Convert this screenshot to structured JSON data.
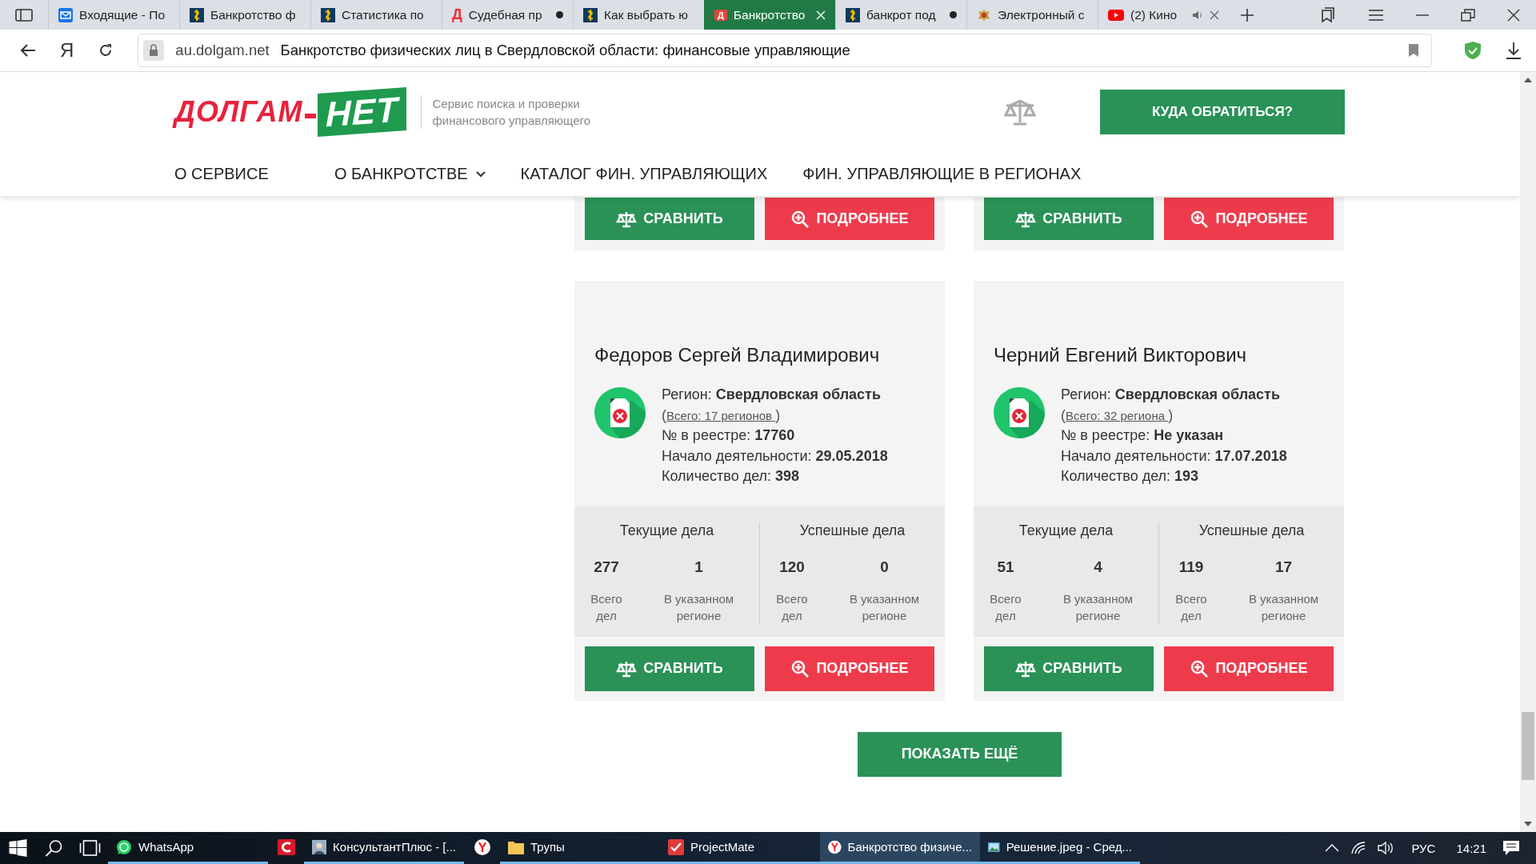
{
  "browser": {
    "tabs": [
      {
        "title": "Входящие - По",
        "kind": "mail",
        "selected": false,
        "unsaved": false,
        "audio": false,
        "closable": false
      },
      {
        "title": "Банкротство ф",
        "kind": "coin",
        "selected": false,
        "unsaved": false,
        "audio": false,
        "closable": false
      },
      {
        "title": "Статистика по",
        "kind": "coin",
        "selected": false,
        "unsaved": false,
        "audio": false,
        "closable": false
      },
      {
        "title": "Судебная пр",
        "kind": "letter",
        "icon_text": "Д",
        "selected": false,
        "unsaved": true,
        "audio": false,
        "closable": false
      },
      {
        "title": "Как выбрать ю",
        "kind": "coin",
        "selected": false,
        "unsaved": false,
        "audio": false,
        "closable": false
      },
      {
        "title": "Банкротство",
        "kind": "site",
        "icon_text": "Д",
        "selected": true,
        "unsaved": false,
        "audio": false,
        "closable": true
      },
      {
        "title": "банкрот под",
        "kind": "coin",
        "selected": false,
        "unsaved": true,
        "audio": false,
        "closable": false
      },
      {
        "title": "Электронный с",
        "kind": "emblem",
        "selected": false,
        "unsaved": false,
        "audio": false,
        "closable": false
      },
      {
        "title": "(2) Кино",
        "kind": "video",
        "selected": false,
        "unsaved": false,
        "audio": true,
        "closable": true
      }
    ],
    "home_glyph": "Я",
    "address": {
      "domain": "au.dolgam.net",
      "title": "Банкротство физических лиц в Свердловской области: финансовые управляющие"
    }
  },
  "site": {
    "logo": {
      "left": "ДОЛГАМ",
      "right": "НЕТ"
    },
    "tagline": [
      "Сервис поиска и проверки",
      "финансового управляющего"
    ],
    "cta": "КУДА ОБРАТИТЬСЯ?",
    "nav": [
      {
        "label": "О СЕРВИСЕ",
        "dropdown": false
      },
      {
        "label": "О БАНКРОТСТВЕ",
        "dropdown": true
      },
      {
        "label": "КАТАЛОГ ФИН. УПРАВЛЯЮЩИХ",
        "dropdown": false
      },
      {
        "label": "ФИН. УПРАВЛЯЮЩИЕ В РЕГИОНАХ",
        "dropdown": false
      }
    ]
  },
  "top_cards": [
    {
      "compare": "СРАВНИТЬ",
      "details": "ПОДРОБНЕЕ"
    },
    {
      "compare": "СРАВНИТЬ",
      "details": "ПОДРОБНЕЕ"
    }
  ],
  "managers": [
    {
      "name": "Федоров Сергей Владимирович",
      "region_label": "Регион:",
      "region": "Свердловская область",
      "regions_open": "(",
      "regions_link": "Всего: 17 регионов ",
      "regions_close": ")",
      "fields": [
        {
          "label": "№ в реестре:",
          "value": "17760"
        },
        {
          "label": "Начало деятельности:",
          "value": "29.05.2018"
        },
        {
          "label": "Количество дел:",
          "value": "398"
        }
      ],
      "stats": [
        {
          "title": "Текущие дела",
          "items": [
            {
              "value": "277",
              "label": "Всего дел"
            },
            {
              "value": "1",
              "label": "В указанном регионе"
            }
          ]
        },
        {
          "title": "Успешные дела",
          "items": [
            {
              "value": "120",
              "label": "Всего дел"
            },
            {
              "value": "0",
              "label": "В указанном регионе"
            }
          ]
        }
      ],
      "compare": "СРАВНИТЬ",
      "details": "ПОДРОБНЕЕ"
    },
    {
      "name": "Черний Евгений Викторович",
      "region_label": "Регион:",
      "region": "Свердловская область",
      "regions_open": "(",
      "regions_link": "Всего: 32 региона ",
      "regions_close": ")",
      "fields": [
        {
          "label": "№ в реестре:",
          "value": "Не указан"
        },
        {
          "label": "Начало деятельности:",
          "value": "17.07.2018"
        },
        {
          "label": "Количество дел:",
          "value": "193"
        }
      ],
      "stats": [
        {
          "title": "Текущие дела",
          "items": [
            {
              "value": "51",
              "label": "Всего дел"
            },
            {
              "value": "4",
              "label": "В указанном регионе"
            }
          ]
        },
        {
          "title": "Успешные дела",
          "items": [
            {
              "value": "119",
              "label": "Всего дел"
            },
            {
              "value": "17",
              "label": "В указанном регионе"
            }
          ]
        }
      ],
      "compare": "СРАВНИТЬ",
      "details": "ПОДРОБНЕЕ"
    }
  ],
  "load_more": "ПОКАЗАТЬ ЕЩЁ",
  "taskbar": {
    "items": [
      {
        "kind": "whatsapp",
        "label": "WhatsApp",
        "running": true,
        "selected": false
      },
      {
        "kind": "red-app",
        "running": false,
        "selected": false
      },
      {
        "kind": "portrait",
        "label": "КонсультантПлюс - [...",
        "running": true,
        "selected": false
      },
      {
        "kind": "yandex",
        "running": false,
        "selected": false
      },
      {
        "kind": "folder",
        "label": "Трупы",
        "running": true,
        "selected": false
      },
      {
        "kind": "check-app",
        "label": "ProjectMate",
        "running": true,
        "selected": false
      },
      {
        "kind": "yandex",
        "label": "Банкротство физиче...",
        "running": true,
        "selected": true
      },
      {
        "kind": "image",
        "label": "Решение.jpeg - Сред...",
        "running": true,
        "selected": false
      }
    ],
    "language": "РУС",
    "time": "14:21"
  }
}
